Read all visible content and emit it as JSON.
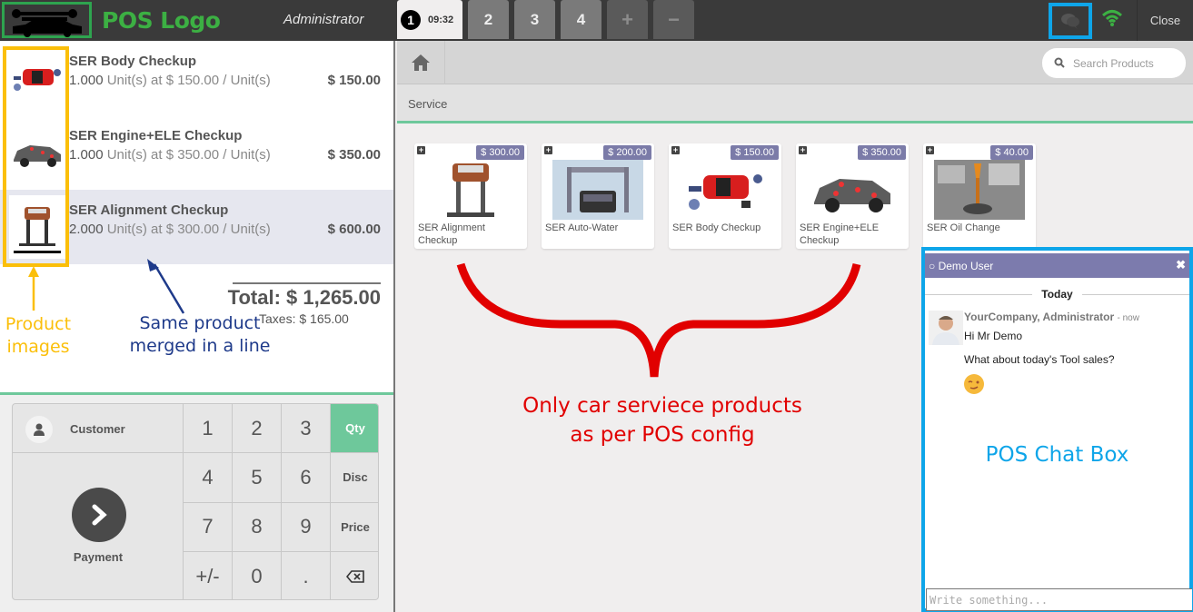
{
  "topbar": {
    "logo_label": "POS Logo",
    "user": "Administrator",
    "order_tabs": [
      {
        "number": "1",
        "time": "09:32",
        "active": true
      },
      {
        "number": "2"
      },
      {
        "number": "3"
      },
      {
        "number": "4"
      }
    ],
    "add_order_icon": "plus-icon",
    "remove_order_icon": "minus-icon",
    "chat_icon": "chat-bubbles-icon",
    "wifi_icon": "wifi-icon",
    "close_label": "Close",
    "colors": {
      "logo_green": "#3cb043",
      "chat_highlight": "#0ea5e9",
      "wifi": "#3cb043"
    }
  },
  "order": {
    "lines": [
      {
        "name": "SER Body Checkup",
        "qty": "1.000",
        "unit_info": "Unit(s) at $ 150.00 / Unit(s)",
        "price": "$ 150.00",
        "selected": false,
        "image": "red-car-parts"
      },
      {
        "name": "SER Engine+ELE Checkup",
        "qty": "1.000",
        "unit_info": "Unit(s) at $ 350.00 / Unit(s)",
        "price": "$ 350.00",
        "selected": false,
        "image": "grey-car-engine"
      },
      {
        "name": "SER Alignment Checkup",
        "qty": "2.000",
        "unit_info": "Unit(s) at $ 300.00 / Unit(s)",
        "price": "$ 600.00",
        "selected": true,
        "image": "car-on-lift"
      }
    ],
    "total": "Total: $ 1,265.00",
    "taxes": "Taxes: $ 165.00"
  },
  "annotations": {
    "product_images": [
      "Product",
      "images"
    ],
    "merged": [
      "Same product",
      "merged in a line"
    ],
    "config": [
      "Only car serviece products",
      "as per POS config"
    ],
    "chat_box": "POS Chat Box"
  },
  "keypad": {
    "customer_label": "Customer",
    "payment_label": "Payment",
    "keys": [
      "1",
      "2",
      "3",
      "Qty",
      "4",
      "5",
      "6",
      "Disc",
      "7",
      "8",
      "9",
      "Price",
      "+/-",
      "0",
      ".",
      "⌫"
    ],
    "active_mode": "Qty",
    "accent": "#6ec89b"
  },
  "products_screen": {
    "search_placeholder": "Search Products",
    "breadcrumb": "Service",
    "products": [
      {
        "name": "SER Alignment Checkup",
        "price": "$ 300.00",
        "image": "car-on-lift"
      },
      {
        "name": "SER Auto-Water",
        "price": "$ 200.00",
        "image": "car-wash"
      },
      {
        "name": "SER Body Checkup",
        "price": "$ 150.00",
        "image": "red-car-parts"
      },
      {
        "name": "SER Engine+ELE Checkup",
        "price": "$ 350.00",
        "image": "grey-car-engine"
      },
      {
        "name": "SER Oil Change",
        "price": "$ 40.00",
        "image": "oil-pour"
      }
    ],
    "price_tag_color": "#7b7ba8"
  },
  "chat": {
    "title": "Demo User",
    "day_label": "Today",
    "author": "YourCompany, Administrator",
    "time": "- now",
    "messages": [
      "Hi Mr Demo",
      "What about today's Tool sales?"
    ],
    "emoji": "wink-emoji",
    "input_placeholder": "Write something...",
    "header_color": "#7c7bad"
  }
}
